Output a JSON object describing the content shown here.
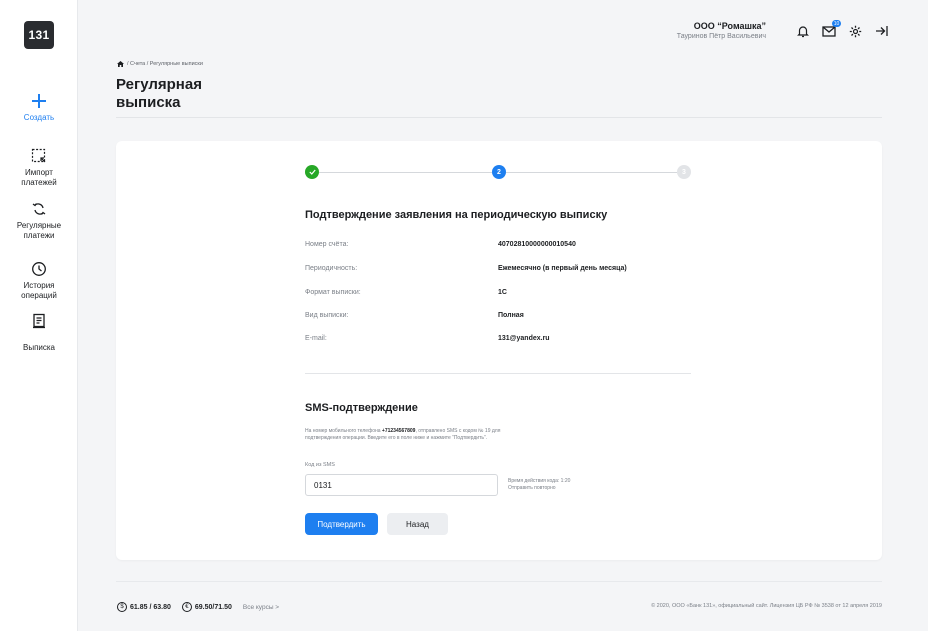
{
  "logo": {
    "text": "131"
  },
  "sidebar": {
    "items": [
      {
        "label": "Создать"
      },
      {
        "label": "Импорт\nплатежей"
      },
      {
        "label": "Регулярные\nплатежи"
      },
      {
        "label": "История\nопераций"
      },
      {
        "label": "Выписка"
      }
    ]
  },
  "header": {
    "company_name": "ООО “Ромашка”",
    "user_name": "Тауринов Пётр Васильевич",
    "mail_badge": "10"
  },
  "breadcrumb": {
    "path": "/ Счета / Регулярные выписки"
  },
  "page": {
    "title": "Регулярная выписка"
  },
  "stepper": {
    "step1": "",
    "step2": "2",
    "step3": "3"
  },
  "confirm": {
    "title": "Подтверждение заявления на периодическую выписку",
    "rows": [
      {
        "label": "Номер счёта:",
        "value": "40702810000000010540"
      },
      {
        "label": "Периодичность:",
        "value": "Ежемесячно (в первый день месяца)"
      },
      {
        "label": "Формат выписки:",
        "value": "1С"
      },
      {
        "label": "Вид выписки:",
        "value": "Полная"
      },
      {
        "label": "E-mail:",
        "value": "131@yandex.ru"
      }
    ]
  },
  "sms": {
    "title": "SMS-подтверждение",
    "desc_before": "На номер мобильного телефона ",
    "phone": "+71234567809",
    "desc_after": ", отправлено SMS с кодом № 19 для подтверждения операции. Введите его в поле ниже и нажмите “Подтвердить”.",
    "code_label": "Код из SMS",
    "code_value": "0131",
    "validity": "Время действия кода: 1:20",
    "resend": "Отправить повторно"
  },
  "buttons": {
    "confirm": "Подтвердить",
    "back": "Назад"
  },
  "footer": {
    "usd_rate": "61.85 / 63.80",
    "eur_rate": "69.50/71.50",
    "usd_symbol": "$",
    "eur_symbol": "€",
    "all_rates": "Все курсы >",
    "copyright": "© 2020, ООО «Банк 131», официальный сайт. Лицензия ЦБ РФ № 3538 от 12 апреля 2019"
  },
  "colors": {
    "accent": "#1e7ff0",
    "success": "#27a827",
    "dark": "#2a2c30"
  }
}
